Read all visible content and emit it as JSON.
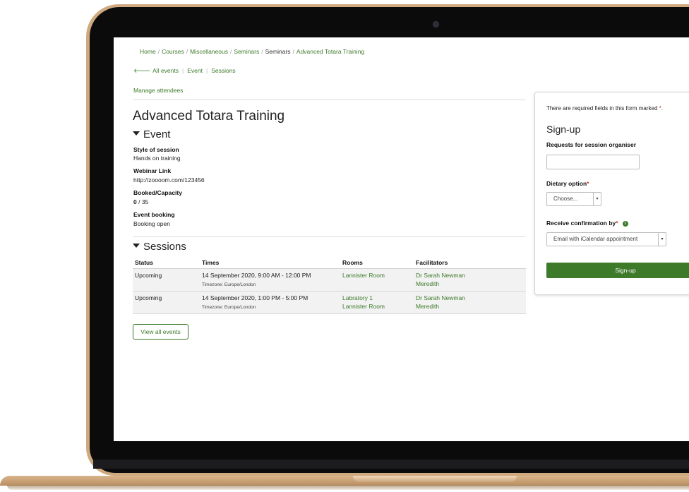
{
  "breadcrumb": [
    "Home",
    "Courses",
    "Miscellaneous",
    "Seminars",
    "Seminars",
    "Advanced Totara Training"
  ],
  "breadcrumb_separator": "/",
  "nav": {
    "back_arrow": "🡐",
    "all_events": "All events",
    "event": "Event",
    "sessions": "Sessions"
  },
  "manage_attendees": "Manage attendees",
  "page_title": "Advanced Totara Training",
  "event_section": {
    "heading": "Event",
    "fields": [
      {
        "label": "Style of session",
        "value": "Hands on training"
      },
      {
        "label": "Webinar Link",
        "value": "http://zoooom.com/123456"
      },
      {
        "label": "Booked/Capacity",
        "booked": "0",
        "capacity": "/ 35"
      },
      {
        "label": "Event booking",
        "value": "Booking open"
      }
    ]
  },
  "sessions_section": {
    "heading": "Sessions",
    "columns": [
      "Status",
      "Times",
      "Rooms",
      "Facilitators"
    ],
    "rows": [
      {
        "status": "Upcoming",
        "time": "14 September 2020, 9:00 AM - 12:00 PM",
        "timezone": "Timezone: Europe/London",
        "rooms": [
          "Lannister Room",
          ""
        ],
        "facilitators": [
          "Dr Sarah Newman",
          "Meredith"
        ]
      },
      {
        "status": "Upcoming",
        "time": "14 September 2020, 1:00 PM - 5:00 PM",
        "timezone": "Timezone: Europe/London",
        "rooms": [
          "Labratory 1",
          "Lannister Room"
        ],
        "facilitators": [
          "Dr Sarah Newman",
          "Meredith"
        ]
      }
    ]
  },
  "view_all_events": "View all events",
  "signup_panel": {
    "required_note": "There are required fields in this form marked",
    "required_star": "*",
    "required_period": ".",
    "title": "Sign-up",
    "requests_label": "Requests for session organiser",
    "requests_value": "",
    "dietary_label": "Dietary option",
    "dietary_selected": "Choose...",
    "confirmation_label": "Receive confirmation by",
    "confirmation_selected": "Email with iCalendar appointment",
    "submit_label": "Sign-up"
  },
  "colors": {
    "accent": "#3d7a2a",
    "required": "#c0392b",
    "laptop_frame": "#cfa97f",
    "bezel": "#0b0b0c"
  }
}
